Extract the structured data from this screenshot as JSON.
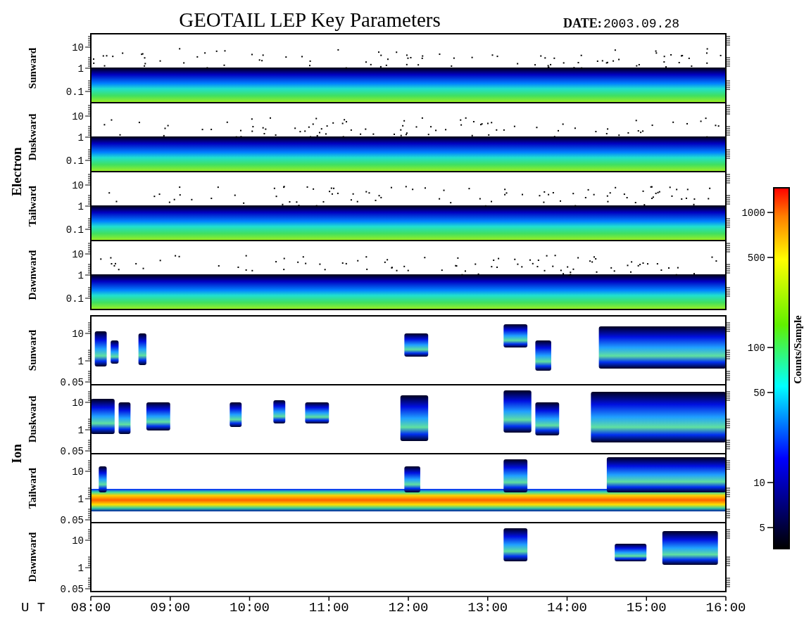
{
  "title": "GEOTAIL LEP Key Parameters",
  "date": {
    "label": "DATE:",
    "value": "2003.09.28"
  },
  "groups": [
    {
      "name": "Electron",
      "panels": [
        {
          "label": "Sunward",
          "y_ticks": [
            "10",
            "1",
            "0.1"
          ]
        },
        {
          "label": "Duskward",
          "y_ticks": [
            "10",
            "1",
            "0.1"
          ]
        },
        {
          "label": "Tailward",
          "y_ticks": [
            "10",
            "1",
            "0.1"
          ]
        },
        {
          "label": "Dawnward",
          "y_ticks": [
            "10",
            "1",
            "0.1"
          ]
        }
      ]
    },
    {
      "name": "Ion",
      "panels": [
        {
          "label": "Sunward",
          "y_ticks": [
            "10",
            "1",
            "0.05"
          ]
        },
        {
          "label": "Duskward",
          "y_ticks": [
            "10",
            "1",
            "0.05"
          ]
        },
        {
          "label": "Tailward",
          "y_ticks": [
            "10",
            "1",
            "0.05"
          ]
        },
        {
          "label": "Dawnward",
          "y_ticks": [
            "10",
            "1",
            "0.05"
          ]
        }
      ]
    }
  ],
  "x_axis": {
    "label": "U T",
    "ticks": [
      "08:00",
      "09:00",
      "10:00",
      "11:00",
      "12:00",
      "13:00",
      "14:00",
      "15:00",
      "16:00"
    ]
  },
  "colorbar": {
    "label": "Counts/Sample",
    "ticks": [
      "1000",
      "500",
      "100",
      "50",
      "10",
      "5"
    ]
  }
}
